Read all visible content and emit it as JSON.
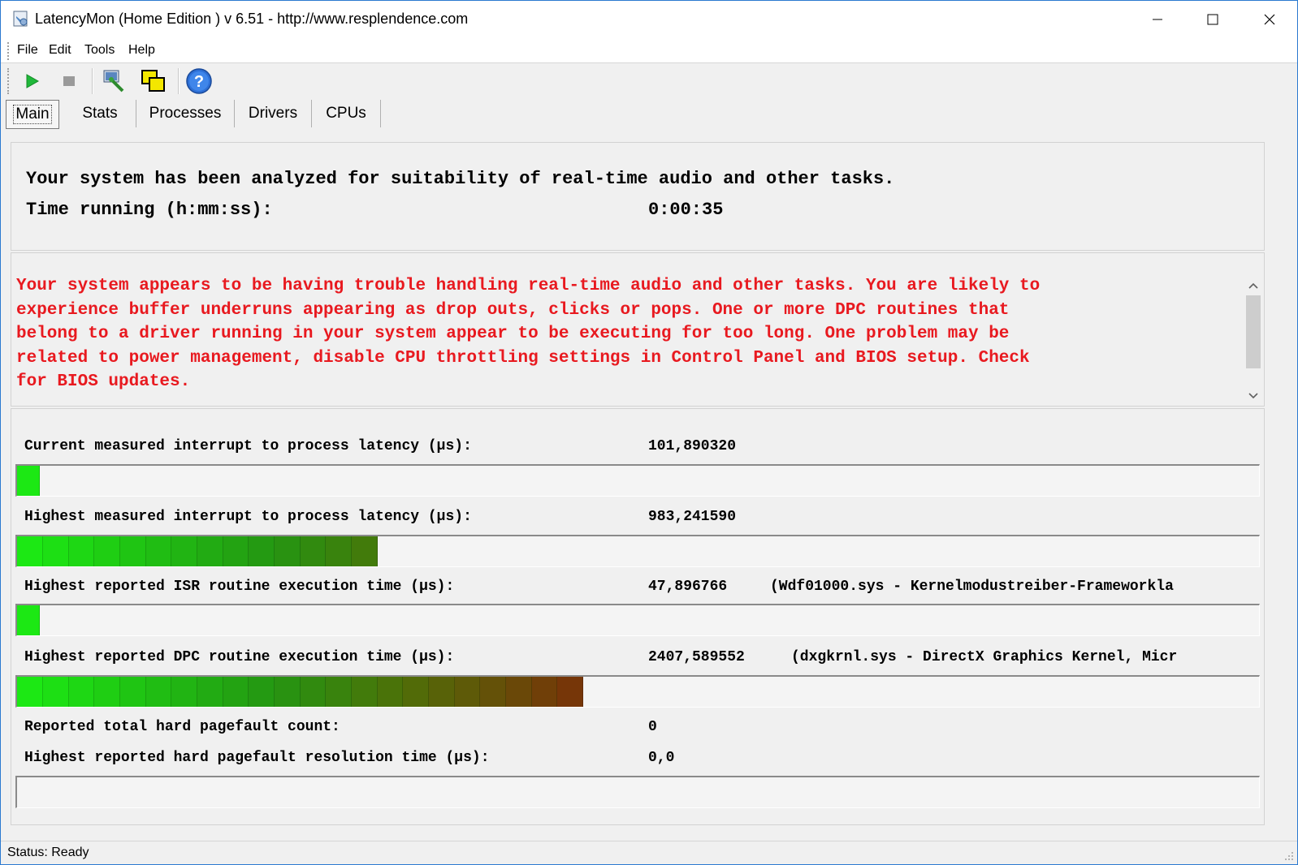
{
  "window": {
    "title": "LatencyMon  (Home Edition )  v 6.51 - http://www.resplendence.com"
  },
  "menu": [
    "File",
    "Edit",
    "Tools",
    "Help"
  ],
  "toolbar": {
    "icons": [
      "play-icon",
      "stop-icon",
      "inspect-icon",
      "windows-icon",
      "help-icon"
    ]
  },
  "tabs": [
    "Main",
    "Stats",
    "Processes",
    "Drivers",
    "CPUs"
  ],
  "summary": {
    "line1": "Your system has been analyzed for suitability of real-time audio and other tasks.",
    "time_label": "Time running (h:mm:ss):",
    "time_value": "0:00:35"
  },
  "warning": {
    "line1": "Your system appears to be having trouble handling real-time audio and other tasks. You are likely to",
    "line2": "experience buffer underruns appearing as drop outs, clicks or pops. One or more DPC routines that",
    "line3": "belong to a driver running in your system appear to be executing for too long. One problem may be",
    "line4": "related to power management, disable CPU throttling settings in Control Panel and BIOS setup. Check",
    "line5": "for BIOS updates.",
    "color": "#e8191f"
  },
  "metrics": {
    "current_latency": {
      "label": "Current measured interrupt to process latency (µs):",
      "value": "101,890320",
      "bar_segments": 1
    },
    "highest_latency": {
      "label": "Highest measured interrupt to process latency (µs):",
      "value": "983,241590",
      "bar_segments": 14
    },
    "isr": {
      "label": "Highest reported ISR routine execution time (µs):",
      "value": "47,896766",
      "driver": "(Wdf01000.sys - Kernelmodustreiber-Frameworkla",
      "bar_segments": 1
    },
    "dpc": {
      "label": "Highest reported DPC routine execution time (µs):",
      "value": "2407,589552",
      "driver": "(dxgkrnl.sys - DirectX Graphics Kernel, Micr",
      "bar_segments": 22
    },
    "pagefault_count": {
      "label": "Reported total hard pagefault count:",
      "value": "0"
    },
    "pagefault_time": {
      "label": "Highest reported hard pagefault resolution time (µs):",
      "value": "0,0",
      "bar_segments": 0
    }
  },
  "status": {
    "text": "Status: Ready"
  }
}
